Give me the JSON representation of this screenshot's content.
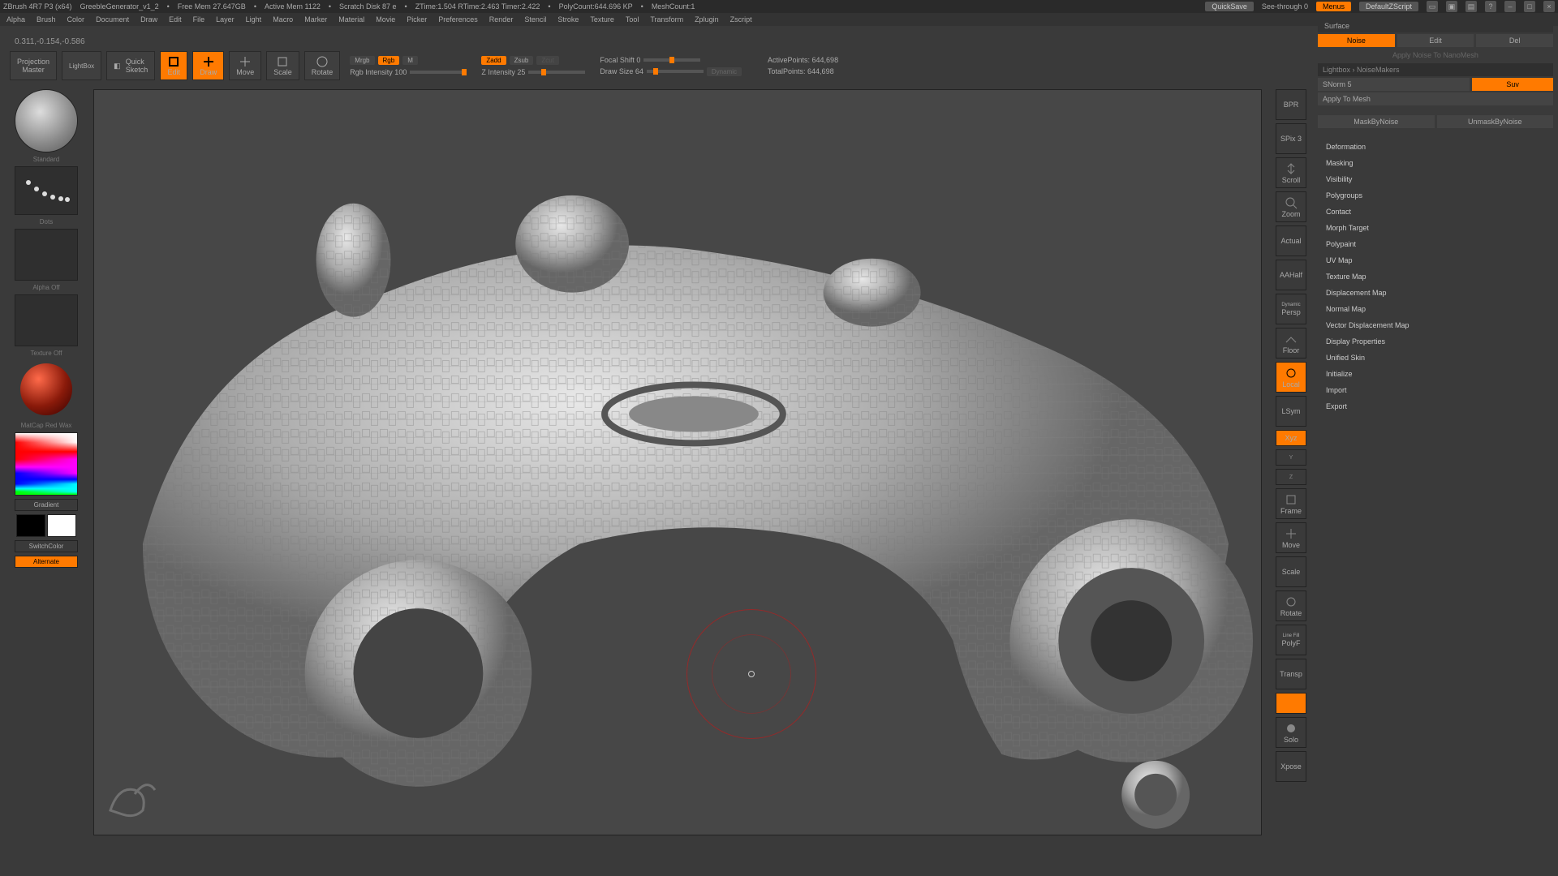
{
  "title": {
    "app": "ZBrush 4R7 P3 (x64)",
    "doc": "GreebleGenerator_v1_2",
    "freemem": "Free Mem 27.647GB",
    "activemem": "Active Mem 1122",
    "scratch": "Scratch Disk 87 e",
    "ztime": "ZTime:1.504 RTime:2.463 Timer:2.422",
    "polycount": "PolyCount:644.696 KP",
    "meshcount": "MeshCount:1",
    "quicksave": "QuickSave",
    "seethrough": "See-through  0",
    "menus": "Menus",
    "script": "DefaultZScript"
  },
  "menu": [
    "Alpha",
    "Brush",
    "Color",
    "Document",
    "Draw",
    "Edit",
    "File",
    "Layer",
    "Light",
    "Macro",
    "Marker",
    "Material",
    "Movie",
    "Picker",
    "Preferences",
    "Render",
    "Stencil",
    "Stroke",
    "Texture",
    "Tool",
    "Transform",
    "Zplugin",
    "Zscript"
  ],
  "coord": "0.311,-0.154,-0.586",
  "shelf": {
    "proj1": "Projection",
    "proj2": "Master",
    "lightbox": "LightBox",
    "quick1": "Quick",
    "quick2": "Sketch",
    "edit": "Edit",
    "draw": "Draw",
    "move": "Move",
    "scale": "Scale",
    "rotate": "Rotate",
    "mrgb": "Mrgb",
    "rgb": "Rgb",
    "m": "M",
    "rgbint": "Rgb Intensity 100",
    "zadd": "Zadd",
    "zsub": "Zsub",
    "zcut": "Zcut",
    "zint": "Z Intensity 25",
    "focal": "Focal Shift 0",
    "drawsize": "Draw Size 64",
    "dynamic": "Dynamic",
    "active": "ActivePoints: 644,698",
    "total": "TotalPoints: 644,698"
  },
  "left": {
    "brush": "Standard",
    "stroke": "Dots",
    "alpha": "Alpha Off",
    "texture": "Texture Off",
    "material": "MatCap Red Wax",
    "gradient": "Gradient",
    "switch": "SwitchColor",
    "alternate": "Alternate"
  },
  "nav": {
    "bprl": "BPR",
    "spix": "SPix 3",
    "scroll": "Scroll",
    "zoom": "Zoom",
    "actual": "Actual",
    "aahalf": "AAHalf",
    "persp": "Persp",
    "floor": "Floor",
    "local": "Local",
    "lsym": "LSym",
    "xyz": "Xyz",
    "frame": "Frame",
    "move": "Move",
    "scale": "Scale",
    "rotate": "Rotate",
    "polyf": "PolyF",
    "transp": "Transp",
    "solo": "Solo",
    "xpose": "Xpose",
    "linefill": "Line Fill",
    "dynamic": "Dynamic"
  },
  "r": {
    "surface": "Surface",
    "noise": "Noise",
    "edit": "Edit",
    "del": "Del",
    "applyhint": "Apply Noise To NanoMesh",
    "lightbox": "Lightbox › NoiseMakers",
    "snorm": "SNorm 5",
    "suv": "Suv",
    "apply": "Apply To Mesh",
    "mask": "MaskByNoise",
    "unmask": "UnmaskByNoise",
    "subs": [
      "Deformation",
      "Masking",
      "Visibility",
      "Polygroups",
      "Contact",
      "Morph Target",
      "Polypaint",
      "UV Map",
      "Texture Map",
      "Displacement Map",
      "Normal Map",
      "Vector Displacement Map",
      "Display Properties",
      "Unified Skin",
      "Initialize",
      "Import",
      "Export"
    ]
  }
}
